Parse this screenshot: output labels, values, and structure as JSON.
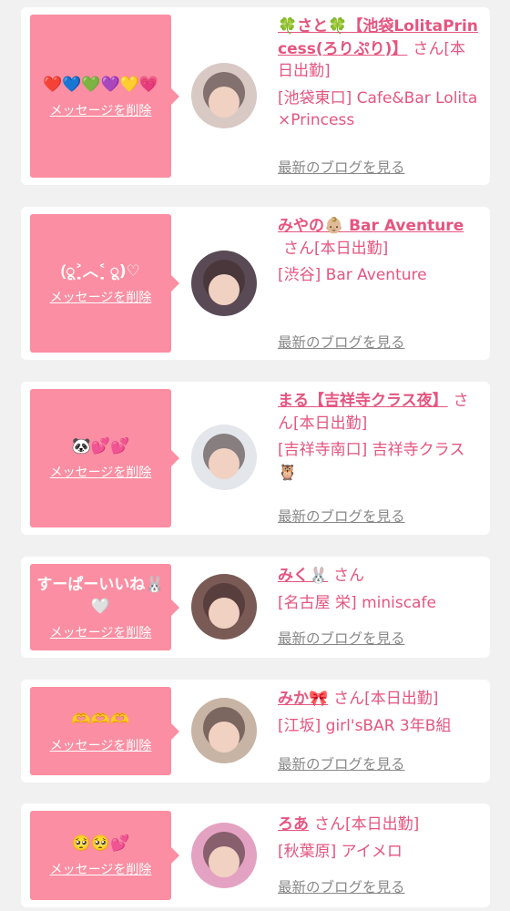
{
  "delete_label": "メッセージを削除",
  "blog_label": "最新のブログを見る",
  "suffix": "さん",
  "colors": {
    "background": "#f1f1f1",
    "card": "#ffffff",
    "bubble": "#fb8ea2",
    "accent_text": "#e5557f",
    "link_gray": "#888888"
  },
  "entries": [
    {
      "message": "❤️💙💚💜💛💗",
      "name": "🍀さと🍀【池袋LolitaPrincess(ろりぷり)】",
      "status": "[本日出勤]",
      "shop": "[池袋東口] Cafe&Bar Lolita×Princess",
      "show_blog": true,
      "avatar_color": "#d8c9c4"
    },
    {
      "message": "(ू˃̣̣̣̣̣̣︿˂̣̣̣̣̣̣ ू)♡",
      "name": "みやの👶🏼 Bar Aventure",
      "status": "[本日出勤]",
      "shop": "[渋谷] Bar Aventure",
      "show_blog": true,
      "avatar_color": "#5a4a55"
    },
    {
      "message": "🐼💕💕",
      "name": "まる【吉祥寺クラス夜】",
      "status": "[本日出勤]",
      "shop": "[吉祥寺南口] 吉祥寺クラス🦉",
      "show_blog": true,
      "avatar_color": "#e3e6ea"
    },
    {
      "message": "すーぱーいいね🐰🤍",
      "name": "みく🐰",
      "status": "",
      "shop": "[名古屋 栄] miniscafe",
      "show_blog": true,
      "avatar_color": "#7a5a55"
    },
    {
      "message": "🫶🫶🫶",
      "name": "みか🎀",
      "status": "[本日出勤]",
      "shop": "[江坂] girl'sBAR 3年B組",
      "show_blog": true,
      "avatar_color": "#c8b4a4"
    },
    {
      "message": "🥺🥺💕",
      "name": "ろあ",
      "status": "[本日出勤]",
      "shop": "[秋葉原] アイメロ",
      "show_blog": true,
      "avatar_color": "#e4a2c2"
    }
  ]
}
